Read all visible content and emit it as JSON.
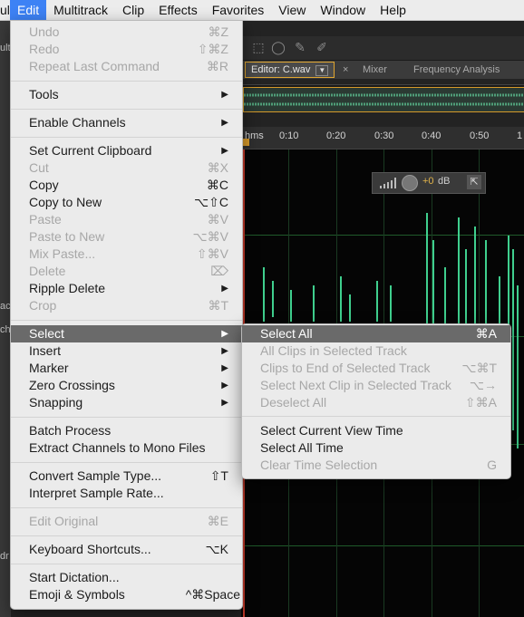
{
  "menubar": {
    "items": [
      {
        "label": "ult",
        "name": "menu-clipped",
        "active": false
      },
      {
        "label": "Edit",
        "name": "menu-edit",
        "active": true
      },
      {
        "label": "Multitrack",
        "name": "menu-multitrack",
        "active": false
      },
      {
        "label": "Clip",
        "name": "menu-clip",
        "active": false
      },
      {
        "label": "Effects",
        "name": "menu-effects",
        "active": false
      },
      {
        "label": "Favorites",
        "name": "menu-favorites",
        "active": false
      },
      {
        "label": "View",
        "name": "menu-view",
        "active": false
      },
      {
        "label": "Window",
        "name": "menu-window",
        "active": false
      },
      {
        "label": "Help",
        "name": "menu-help",
        "active": false
      }
    ]
  },
  "app": {
    "tabs": {
      "editor": "Editor: C.wav",
      "close": "×",
      "mixer": "Mixer",
      "freq": "Frequency Analysis"
    },
    "ruler": [
      "hms",
      "0:10",
      "0:20",
      "0:30",
      "0:40",
      "0:50",
      "1"
    ],
    "hud": {
      "gain": "+0",
      "unit": "dB"
    },
    "left_clipped": [
      "ult",
      "ac",
      "ch",
      "dr"
    ]
  },
  "edit_menu": {
    "items": [
      {
        "label": "Undo",
        "shortcut": "⌘Z",
        "disabled": true
      },
      {
        "label": "Redo",
        "shortcut": "⇧⌘Z",
        "disabled": true
      },
      {
        "label": "Repeat Last Command",
        "shortcut": "⌘R",
        "disabled": true
      },
      {
        "sep": true
      },
      {
        "label": "Tools",
        "submenu": true
      },
      {
        "sep": true
      },
      {
        "label": "Enable Channels",
        "submenu": true
      },
      {
        "sep": true
      },
      {
        "label": "Set Current Clipboard",
        "submenu": true
      },
      {
        "label": "Cut",
        "shortcut": "⌘X",
        "disabled": true
      },
      {
        "label": "Copy",
        "shortcut": "⌘C"
      },
      {
        "label": "Copy to New",
        "shortcut": "⌥⇧C"
      },
      {
        "label": "Paste",
        "shortcut": "⌘V",
        "disabled": true
      },
      {
        "label": "Paste to New",
        "shortcut": "⌥⌘V",
        "disabled": true
      },
      {
        "label": "Mix Paste...",
        "shortcut": "⇧⌘V",
        "disabled": true
      },
      {
        "label": "Delete",
        "shortcut": "⌦",
        "disabled": true
      },
      {
        "label": "Ripple Delete",
        "submenu": true
      },
      {
        "label": "Crop",
        "shortcut": "⌘T",
        "disabled": true
      },
      {
        "sep": true
      },
      {
        "label": "Select",
        "submenu": true,
        "highlighted": true
      },
      {
        "label": "Insert",
        "submenu": true
      },
      {
        "label": "Marker",
        "submenu": true
      },
      {
        "label": "Zero Crossings",
        "submenu": true
      },
      {
        "label": "Snapping",
        "submenu": true
      },
      {
        "sep": true
      },
      {
        "label": "Batch Process"
      },
      {
        "label": "Extract Channels to Mono Files"
      },
      {
        "sep": true
      },
      {
        "label": "Convert Sample Type...",
        "shortcut": "⇧T"
      },
      {
        "label": "Interpret Sample Rate..."
      },
      {
        "sep": true
      },
      {
        "label": "Edit Original",
        "shortcut": "⌘E",
        "disabled": true
      },
      {
        "sep": true
      },
      {
        "label": "Keyboard Shortcuts...",
        "shortcut": "⌥K"
      },
      {
        "sep": true
      },
      {
        "label": "Start Dictation..."
      },
      {
        "label": "Emoji & Symbols",
        "shortcut": "^⌘Space"
      }
    ]
  },
  "select_submenu": {
    "items": [
      {
        "label": "Select All",
        "shortcut": "⌘A",
        "highlighted": true
      },
      {
        "label": "All Clips in Selected Track",
        "disabled": true
      },
      {
        "label": "Clips to End of Selected Track",
        "shortcut": "⌥⌘T",
        "disabled": true
      },
      {
        "label": "Select Next Clip in Selected Track",
        "shortcut": "⌥→",
        "disabled": true
      },
      {
        "label": "Deselect All",
        "shortcut": "⇧⌘A",
        "disabled": true
      },
      {
        "sep": true
      },
      {
        "label": "Select Current View Time"
      },
      {
        "label": "Select All Time"
      },
      {
        "label": "Clear Time Selection",
        "shortcut": "G",
        "disabled": true
      }
    ]
  }
}
